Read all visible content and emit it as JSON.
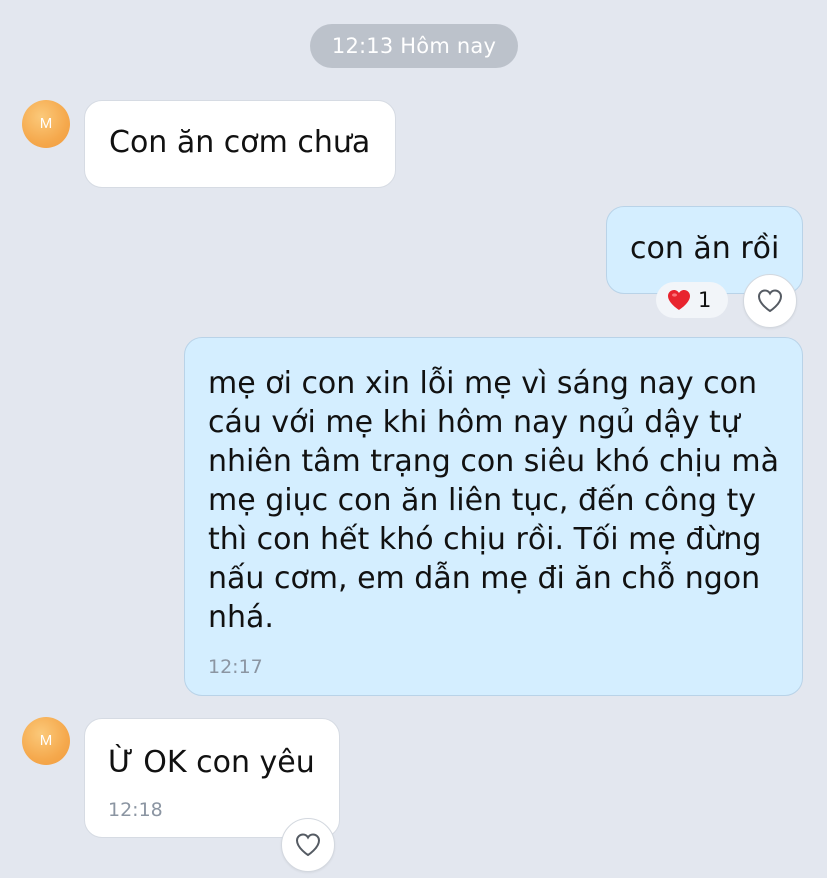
{
  "timestamp_pill": "12:13 Hôm nay",
  "colors": {
    "background": "#e3e7ef",
    "incoming_bubble": "#ffffff",
    "outgoing_bubble": "#d4eeff",
    "avatar": "#f5a94d",
    "reaction_heart": "#e8242e"
  },
  "messages": [
    {
      "direction": "incoming",
      "avatar_letter": "M",
      "text": "Con ăn cơm chưa",
      "time": ""
    },
    {
      "direction": "outgoing",
      "text": "con ăn rồi",
      "time": "",
      "reaction": {
        "icon": "red-heart-emoji",
        "count": "1"
      }
    },
    {
      "direction": "outgoing",
      "text": "mẹ ơi con xin lỗi mẹ vì sáng nay con\ncáu với mẹ khi hôm nay ngủ dậy tự\nnhiên tâm trạng con siêu khó chịu mà\nmẹ giục con ăn liên tục, đến công ty\nthì con hết khó chịu rồi. Tối mẹ đừng\nnấu cơm, em dẫn mẹ đi ăn chỗ ngon\nnhá.",
      "time": "12:17"
    },
    {
      "direction": "incoming",
      "avatar_letter": "M",
      "text": "Ừ OK con yêu",
      "time": "12:18"
    }
  ]
}
